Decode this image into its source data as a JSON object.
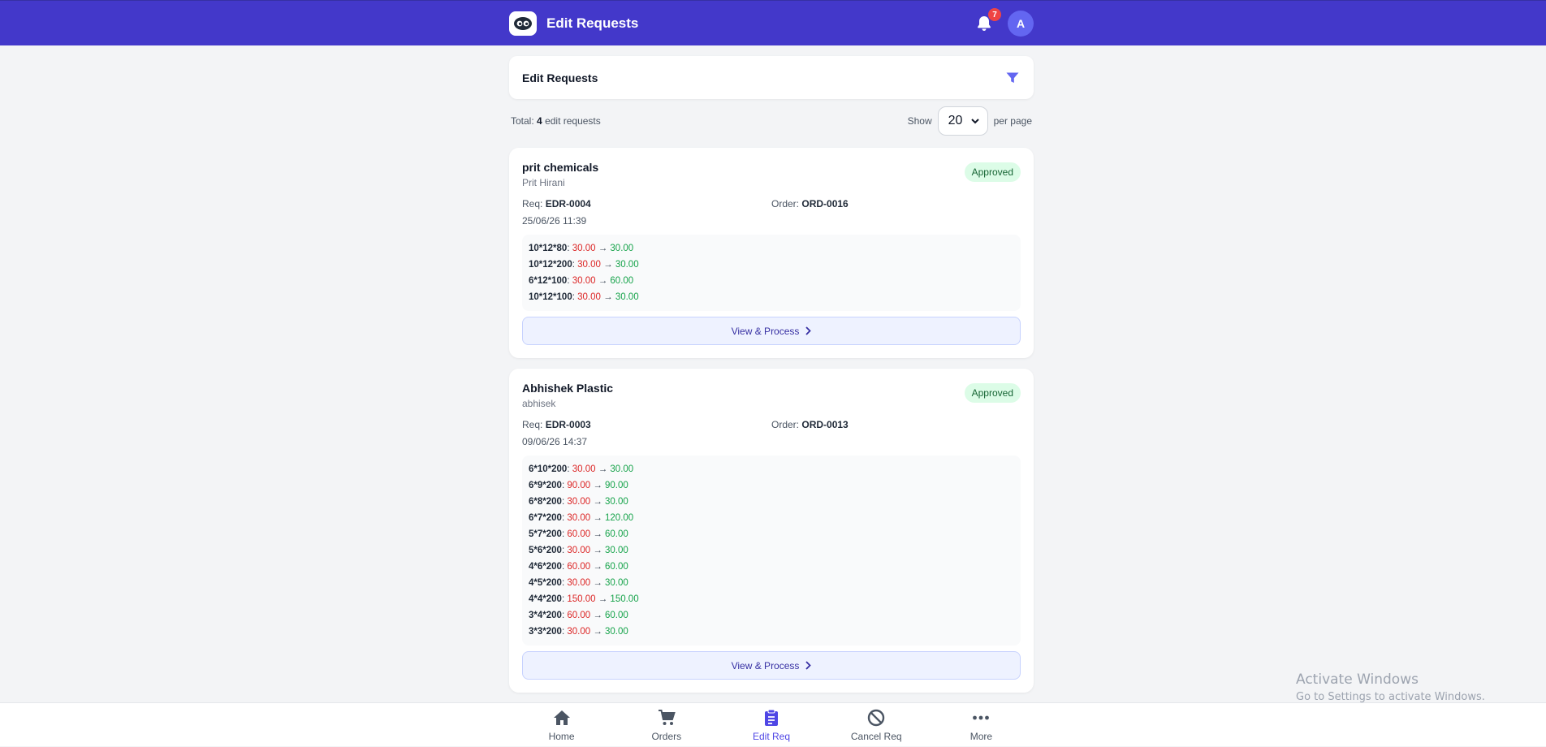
{
  "header": {
    "title": "Edit Requests",
    "notification_count": "7",
    "avatar_initial": "A"
  },
  "panel": {
    "title": "Edit Requests"
  },
  "summary": {
    "total_prefix": "Total:",
    "total_count": "4",
    "total_suffix": "edit requests",
    "show_label": "Show",
    "per_page_value": "20",
    "per_page_label": "per page"
  },
  "requests": [
    {
      "company": "prit chemicals",
      "person": "Prit Hirani",
      "status": "Approved",
      "req_label": "Req:",
      "req_id": "EDR-0004",
      "order_label": "Order:",
      "order_id": "ORD-0016",
      "date": "25/06/26 11:39",
      "changes": [
        {
          "size": "10*12*80",
          "old": "30.00",
          "new": "30.00"
        },
        {
          "size": "10*12*200",
          "old": "30.00",
          "new": "30.00"
        },
        {
          "size": "6*12*100",
          "old": "30.00",
          "new": "60.00"
        },
        {
          "size": "10*12*100",
          "old": "30.00",
          "new": "30.00"
        }
      ],
      "button": "View & Process"
    },
    {
      "company": "Abhishek Plastic",
      "person": "abhisek",
      "status": "Approved",
      "req_label": "Req:",
      "req_id": "EDR-0003",
      "order_label": "Order:",
      "order_id": "ORD-0013",
      "date": "09/06/26 14:37",
      "changes": [
        {
          "size": "6*10*200",
          "old": "30.00",
          "new": "30.00"
        },
        {
          "size": "6*9*200",
          "old": "90.00",
          "new": "90.00"
        },
        {
          "size": "6*8*200",
          "old": "30.00",
          "new": "30.00"
        },
        {
          "size": "6*7*200",
          "old": "30.00",
          "new": "120.00"
        },
        {
          "size": "5*7*200",
          "old": "60.00",
          "new": "60.00"
        },
        {
          "size": "5*6*200",
          "old": "30.00",
          "new": "30.00"
        },
        {
          "size": "4*6*200",
          "old": "60.00",
          "new": "60.00"
        },
        {
          "size": "4*5*200",
          "old": "30.00",
          "new": "30.00"
        },
        {
          "size": "4*4*200",
          "old": "150.00",
          "new": "150.00"
        },
        {
          "size": "3*4*200",
          "old": "60.00",
          "new": "60.00"
        },
        {
          "size": "3*3*200",
          "old": "30.00",
          "new": "30.00"
        }
      ],
      "button": "View & Process"
    }
  ],
  "arrow_glyph": "→",
  "bottom_nav": [
    {
      "label": "Home",
      "icon": "home-icon",
      "active": false
    },
    {
      "label": "Orders",
      "icon": "cart-icon",
      "active": false
    },
    {
      "label": "Edit Req",
      "icon": "clipboard-icon",
      "active": true
    },
    {
      "label": "Cancel Req",
      "icon": "ban-icon",
      "active": false
    },
    {
      "label": "More",
      "icon": "ellipsis-icon",
      "active": false
    }
  ],
  "watermark": {
    "title": "Activate Windows",
    "subtitle": "Go to Settings to activate Windows."
  },
  "colors": {
    "brand": "#4338ca",
    "old_value": "#dc2626",
    "new_value": "#16a34a",
    "approved_bg": "#dcfce7",
    "active_nav": "#4f46e5"
  }
}
